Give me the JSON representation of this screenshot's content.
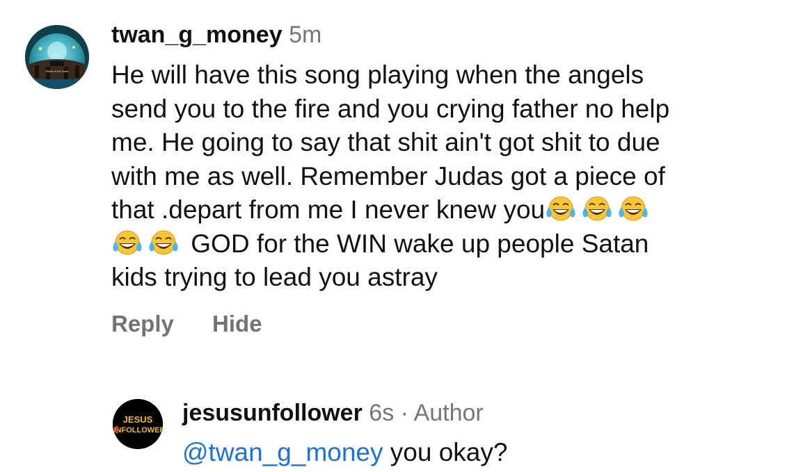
{
  "comment": {
    "username": "twan_g_money",
    "time": "5m",
    "text_lines": [
      "He will have this song playing when the angels",
      "send you to the fire and you crying father no help",
      "me. He going to say that shit ain't got shit to due",
      "with me as well. Remember Judas got a piece of",
      "that .depart from me I never knew you"
    ],
    "text_line6_after_emoji": "GOD for the WIN wake up people Satan",
    "text_line7": "kids trying to lead you astray",
    "emoji_name": "face-with-tears-of-joy",
    "reply_label": "Reply",
    "hide_label": "Hide",
    "avatar_labels": [
      "Pillars of the Earth"
    ]
  },
  "reply": {
    "username": "jesusunfollower",
    "time": "6s",
    "separator": "·",
    "author_badge": "Author",
    "mention": "@twan_g_money",
    "text": "you okay?",
    "avatar_text_top": "JESUS",
    "avatar_text_bottom": "UNFOLLOWER",
    "colors": {
      "avatar_bg": "#000000",
      "avatar_text": "#f5b820",
      "avatar_accent": "#e03a1e"
    }
  },
  "colors": {
    "mention": "#1a73d9",
    "meta": "#767676",
    "action": "#737373"
  }
}
